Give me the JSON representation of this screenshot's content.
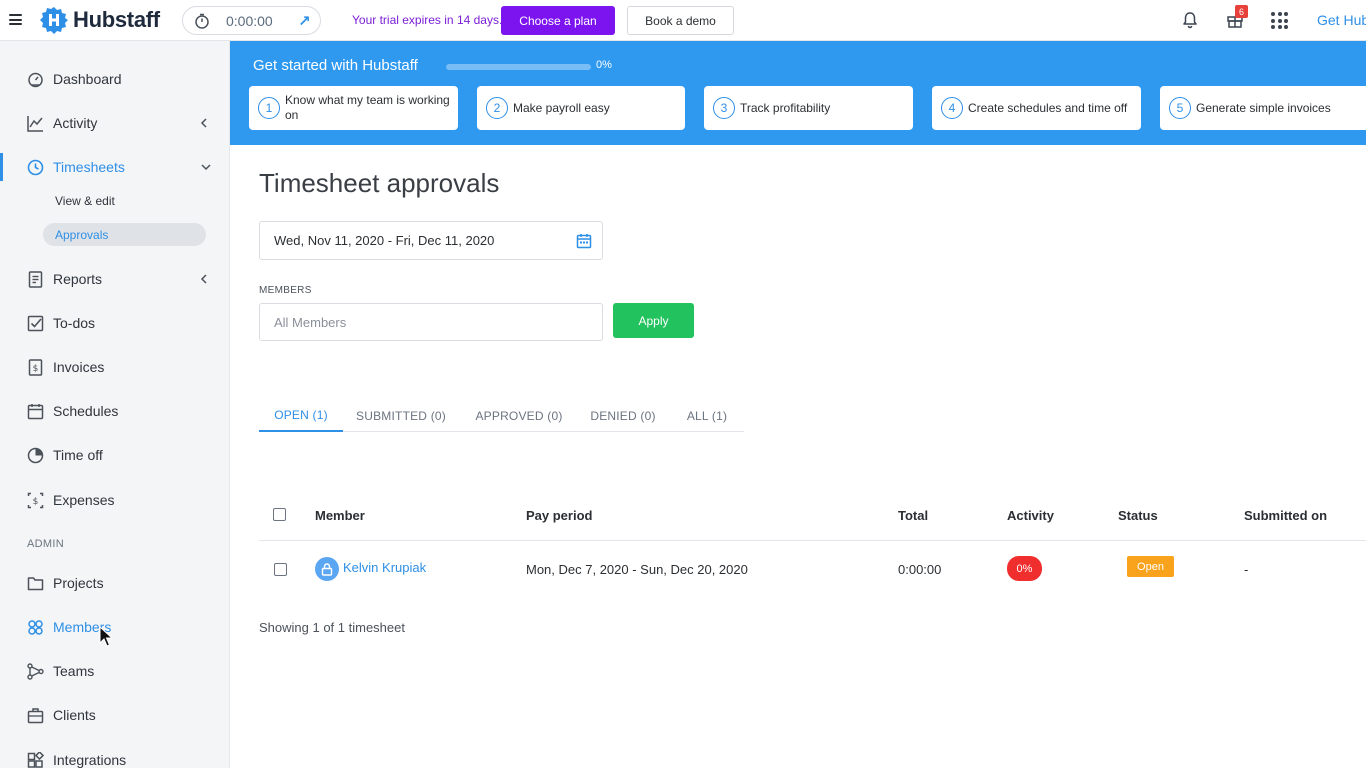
{
  "topbar": {
    "app_name": "Hubstaff",
    "timer_value": "0:00:00",
    "trial_text": "Your trial expires in 14 days.",
    "choose_plan": "Choose a plan",
    "book_demo": "Book a demo",
    "gift_count": "6",
    "get_hub": "Get Hub",
    "icons": [
      "menu-icon",
      "stopwatch-icon",
      "arrow-up-right-icon",
      "bell-icon",
      "gift-icon",
      "apps-grid-icon"
    ]
  },
  "sidebar": {
    "dashboard": "Dashboard",
    "activity": "Activity",
    "timesheets": "Timesheets",
    "view_edit": "View & edit",
    "approvals": "Approvals",
    "reports": "Reports",
    "todos": "To-dos",
    "invoices": "Invoices",
    "schedules": "Schedules",
    "time_off": "Time off",
    "expenses": "Expenses",
    "admin_label": "ADMIN",
    "projects": "Projects",
    "members": "Members",
    "teams": "Teams",
    "clients": "Clients",
    "integrations": "Integrations"
  },
  "banner": {
    "title": "Get started with Hubstaff",
    "progress": 0,
    "progress_label": "0%",
    "steps": [
      {
        "num": "1",
        "label": "Know what my team is working on"
      },
      {
        "num": "2",
        "label": "Make payroll easy"
      },
      {
        "num": "3",
        "label": "Track profitability"
      },
      {
        "num": "4",
        "label": "Create schedules and time off"
      },
      {
        "num": "5",
        "label": "Generate simple invoices"
      }
    ]
  },
  "main": {
    "title": "Timesheet approvals",
    "date_range": "Wed, Nov 11, 2020 - Fri, Dec 11, 2020",
    "members_label": "MEMBERS",
    "members_placeholder": "All Members",
    "apply": "Apply",
    "tabs": [
      {
        "label": "OPEN (1)"
      },
      {
        "label": "SUBMITTED (0)"
      },
      {
        "label": "APPROVED (0)"
      },
      {
        "label": "DENIED (0)"
      },
      {
        "label": "ALL (1)"
      }
    ],
    "table": {
      "headers": [
        "Member",
        "Pay period",
        "Total",
        "Activity",
        "Status",
        "Submitted on"
      ],
      "rows": [
        {
          "member": "Kelvin Krupiak",
          "pay_period": "Mon, Dec 7, 2020 - Sun, Dec 20, 2020",
          "total": "0:00:00",
          "activity": "0%",
          "status": "Open",
          "submitted_on": "-"
        }
      ]
    },
    "showing": "Showing 1 of 1 timesheet"
  },
  "colors": {
    "brand_blue": "#2e8fe6",
    "banner_blue": "#2f99f0",
    "plan_purple": "#7c14f0",
    "apply_green": "#22c35e",
    "activity_red": "#f02e2e",
    "status_orange": "#f9a21b"
  }
}
